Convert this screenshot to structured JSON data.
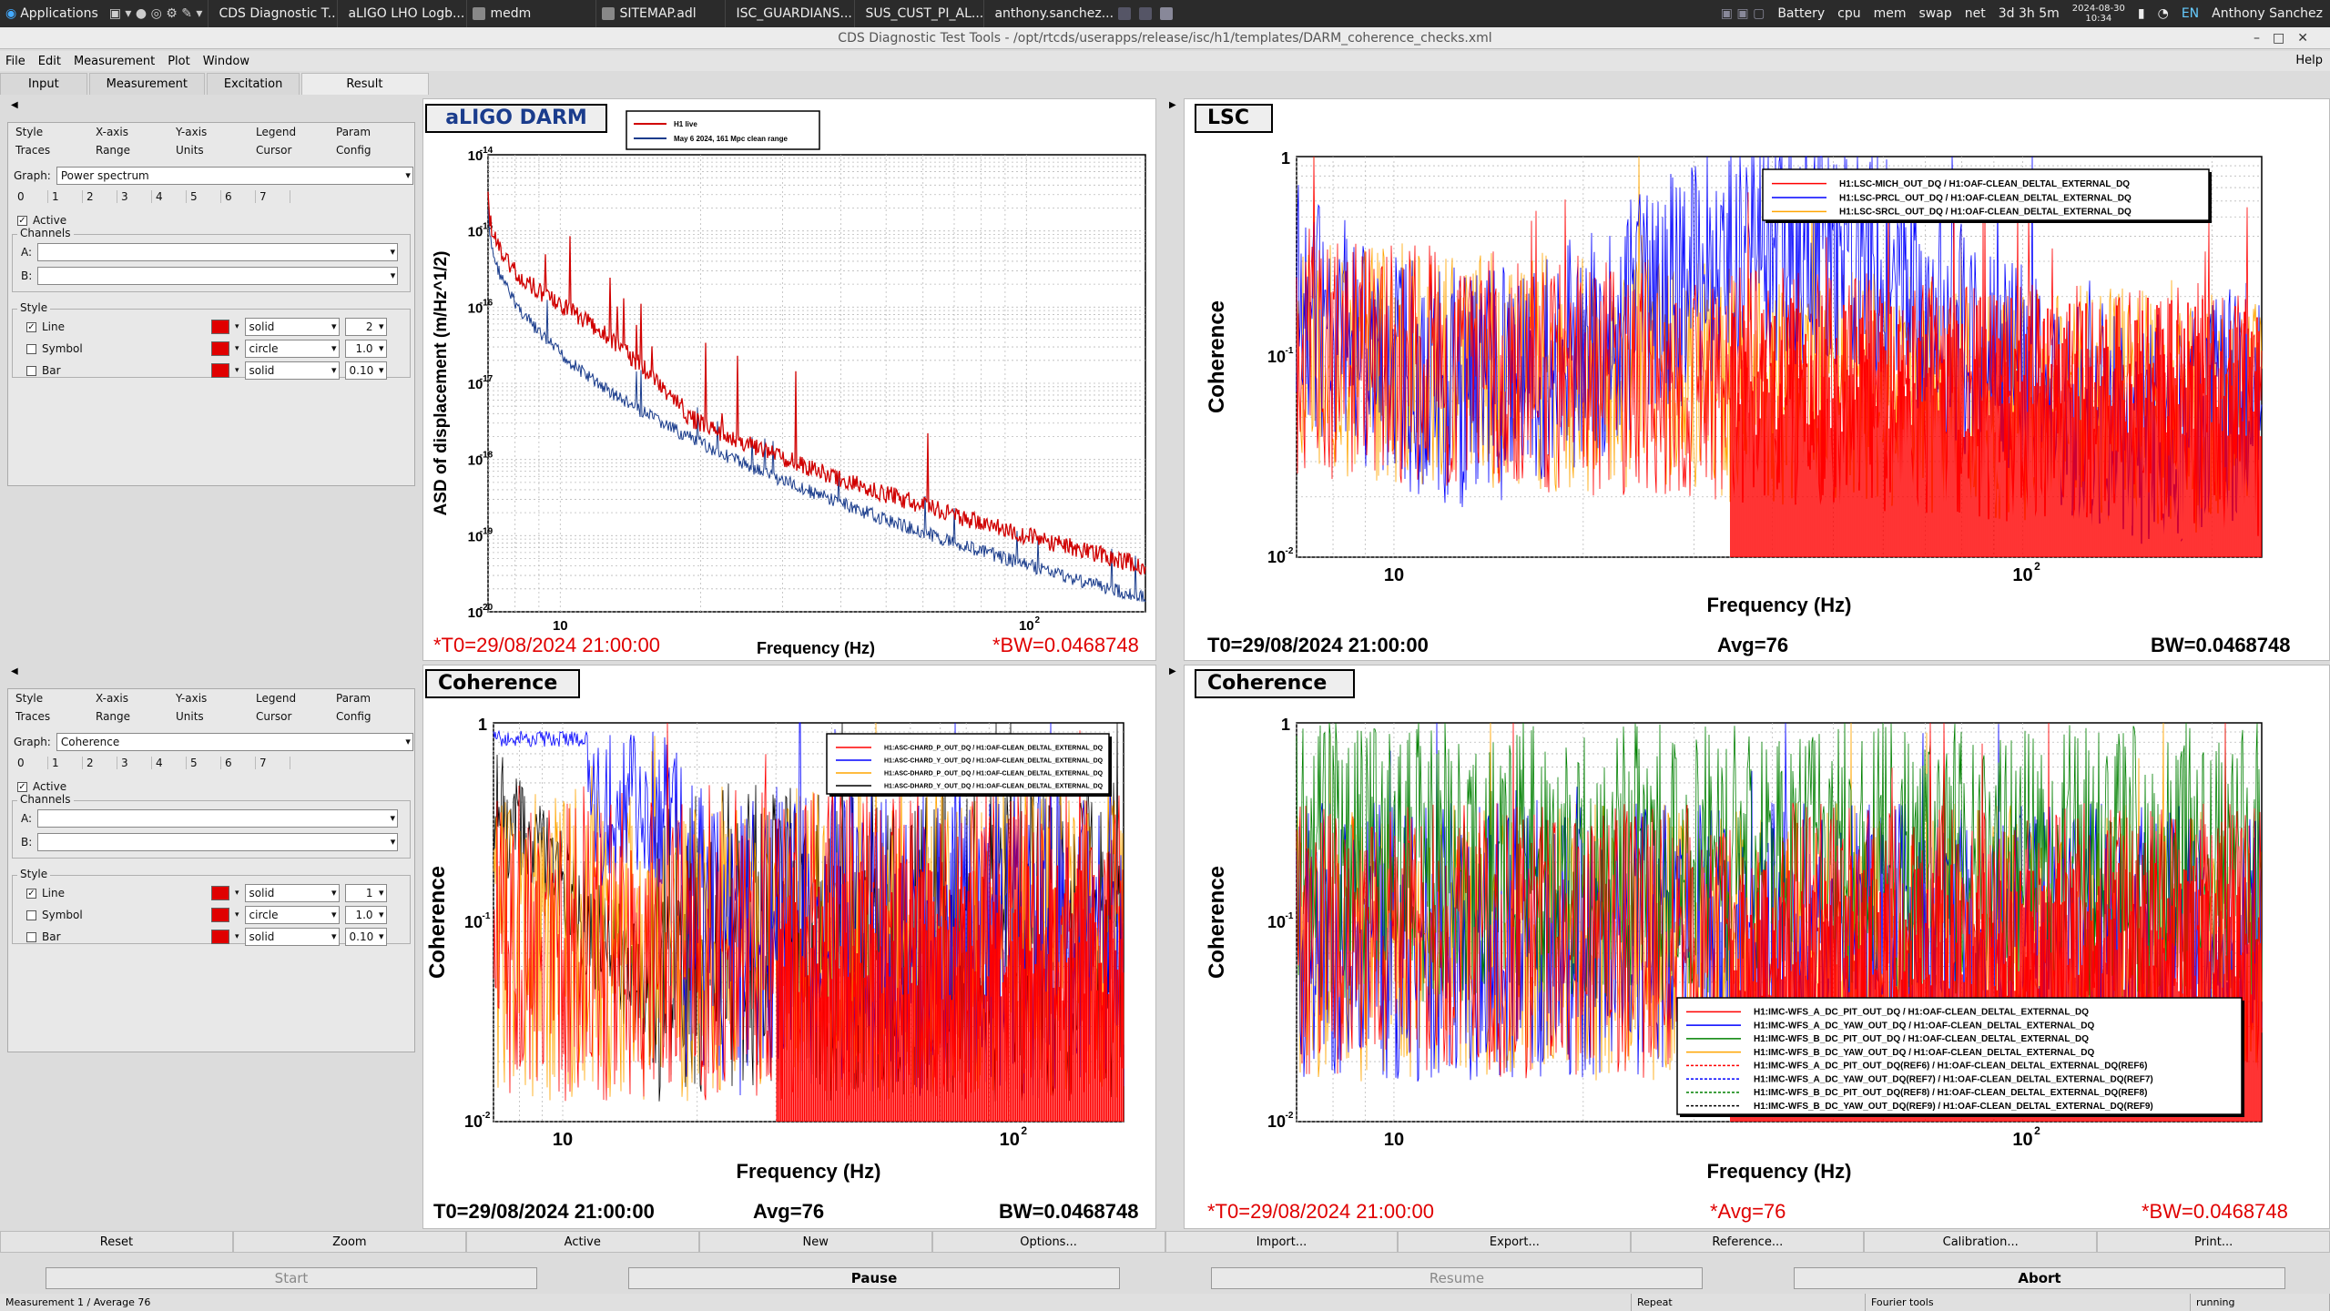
{
  "topbar": {
    "apps": "Applications",
    "tasks": [
      "CDS Diagnostic T...",
      "aLIGO LHO Logb...",
      "medm",
      "SITEMAP.adl",
      "ISC_GUARDIANS...",
      "SUS_CUST_PI_AL...",
      "anthony.sanchez..."
    ],
    "battery": "Battery",
    "cpu": "cpu",
    "mem": "mem",
    "swap": "swap",
    "net": "net",
    "uptime": "3d 3h 5m",
    "date": "2024-08-30",
    "time": "10:34",
    "lang": "EN",
    "user": "Anthony Sanchez"
  },
  "window": {
    "title": "CDS Diagnostic Test Tools - /opt/rtcds/userapps/release/isc/h1/templates/DARM_coherence_checks.xml"
  },
  "menu": {
    "file": "File",
    "edit": "Edit",
    "measurement": "Measurement",
    "plot": "Plot",
    "window": "Window",
    "help": "Help"
  },
  "tabs": [
    "Input",
    "Measurement",
    "Excitation",
    "Result"
  ],
  "panels": [
    {
      "tabs_row1": [
        "Style",
        "X-axis",
        "Y-axis",
        "Legend",
        "Param"
      ],
      "tabs_row2": [
        "Traces",
        "Range",
        "Units",
        "Cursor",
        "Config"
      ],
      "graph_label": "Graph:",
      "graph": "Power spectrum",
      "trace_nums": [
        "0",
        "1",
        "2",
        "3",
        "4",
        "5",
        "6",
        "7"
      ],
      "active": "Active",
      "channels": "Channels",
      "a": "A:",
      "b": "B:",
      "style": "Style",
      "line": "Line",
      "symbol": "Symbol",
      "bar": "Bar",
      "line_style": "solid",
      "symbol_style": "circle",
      "bar_style": "solid",
      "line_w": "2",
      "symbol_w": "1.0",
      "bar_w": "0.10"
    },
    {
      "tabs_row1": [
        "Style",
        "X-axis",
        "Y-axis",
        "Legend",
        "Param"
      ],
      "tabs_row2": [
        "Traces",
        "Range",
        "Units",
        "Cursor",
        "Config"
      ],
      "graph_label": "Graph:",
      "graph": "Coherence",
      "trace_nums": [
        "0",
        "1",
        "2",
        "3",
        "4",
        "5",
        "6",
        "7"
      ],
      "active": "Active",
      "channels": "Channels",
      "a": "A:",
      "b": "B:",
      "style": "Style",
      "line": "Line",
      "symbol": "Symbol",
      "bar": "Bar",
      "line_style": "solid",
      "symbol_style": "circle",
      "bar_style": "solid",
      "line_w": "1",
      "symbol_w": "1.0",
      "bar_w": "0.10"
    }
  ],
  "plots": [
    {
      "title": "aLIGO DARM",
      "t0": "*T0=29/08/2024 21:00:00",
      "xlabel": "Frequency (Hz)",
      "bw": "*BW=0.0468748",
      "avg": "",
      "ylabel": "ASD of displacement (m/Hz^1/2)",
      "legend": [
        "H1 live",
        "May 6 2024, 161 Mpc clean range"
      ],
      "legend_colors": [
        "#d00000",
        "#1a3c8c"
      ]
    },
    {
      "title": "LSC",
      "t0": "T0=29/08/2024 21:00:00",
      "xlabel": "Frequency (Hz)",
      "avg": "Avg=76",
      "bw": "BW=0.0468748",
      "ylabel": "Coherence",
      "legend": [
        "H1:LSC-MICH_OUT_DQ / H1:OAF-CLEAN_DELTAL_EXTERNAL_DQ",
        "H1:LSC-PRCL_OUT_DQ / H1:OAF-CLEAN_DELTAL_EXTERNAL_DQ",
        "H1:LSC-SRCL_OUT_DQ / H1:OAF-CLEAN_DELTAL_EXTERNAL_DQ"
      ],
      "legend_colors": [
        "#ff0000",
        "#0000ff",
        "#ffa500"
      ]
    },
    {
      "title": "Coherence",
      "t0": "T0=29/08/2024 21:00:00",
      "xlabel": "Frequency (Hz)",
      "avg": "Avg=76",
      "bw": "BW=0.0468748",
      "ylabel": "Coherence",
      "legend": [
        "H1:ASC-CHARD_P_OUT_DQ / H1:OAF-CLEAN_DELTAL_EXTERNAL_DQ",
        "H1:ASC-CHARD_Y_OUT_DQ / H1:OAF-CLEAN_DELTAL_EXTERNAL_DQ",
        "H1:ASC-DHARD_P_OUT_DQ / H1:OAF-CLEAN_DELTAL_EXTERNAL_DQ",
        "H1:ASC-DHARD_Y_OUT_DQ / H1:OAF-CLEAN_DELTAL_EXTERNAL_DQ"
      ],
      "legend_colors": [
        "#ff0000",
        "#0000ff",
        "#ffa500",
        "#000000"
      ]
    },
    {
      "title": "Coherence",
      "t0": "*T0=29/08/2024 21:00:00",
      "xlabel": "Frequency (Hz)",
      "avg": "*Avg=76",
      "bw": "*BW=0.0468748",
      "ylabel": "Coherence",
      "legend": [
        "H1:IMC-WFS_A_DC_PIT_OUT_DQ / H1:OAF-CLEAN_DELTAL_EXTERNAL_DQ",
        "H1:IMC-WFS_A_DC_YAW_OUT_DQ / H1:OAF-CLEAN_DELTAL_EXTERNAL_DQ",
        "H1:IMC-WFS_B_DC_PIT_OUT_DQ / H1:OAF-CLEAN_DELTAL_EXTERNAL_DQ",
        "H1:IMC-WFS_B_DC_YAW_OUT_DQ / H1:OAF-CLEAN_DELTAL_EXTERNAL_DQ",
        "H1:IMC-WFS_A_DC_PIT_OUT_DQ(REF6) / H1:OAF-CLEAN_DELTAL_EXTERNAL_DQ(REF6)",
        "H1:IMC-WFS_A_DC_YAW_OUT_DQ(REF7) / H1:OAF-CLEAN_DELTAL_EXTERNAL_DQ(REF7)",
        "H1:IMC-WFS_B_DC_PIT_OUT_DQ(REF8) / H1:OAF-CLEAN_DELTAL_EXTERNAL_DQ(REF8)",
        "H1:IMC-WFS_B_DC_YAW_OUT_DQ(REF9) / H1:OAF-CLEAN_DELTAL_EXTERNAL_DQ(REF9)"
      ],
      "legend_colors": [
        "#ff0000",
        "#0000ff",
        "#008000",
        "#ffa500",
        "#ff0000",
        "#0000ff",
        "#008000",
        "#000000"
      ]
    }
  ],
  "buttons_row1": [
    "Reset",
    "Zoom",
    "Active",
    "New",
    "Options...",
    "Import...",
    "Export...",
    "Reference...",
    "Calibration...",
    "Print..."
  ],
  "buttons_row2": {
    "start": "Start",
    "pause": "Pause",
    "resume": "Resume",
    "abort": "Abort"
  },
  "status": {
    "measurement": "Measurement 1 / Average 76",
    "repeat": "Repeat",
    "fourier": "Fourier tools",
    "state": "running"
  }
}
